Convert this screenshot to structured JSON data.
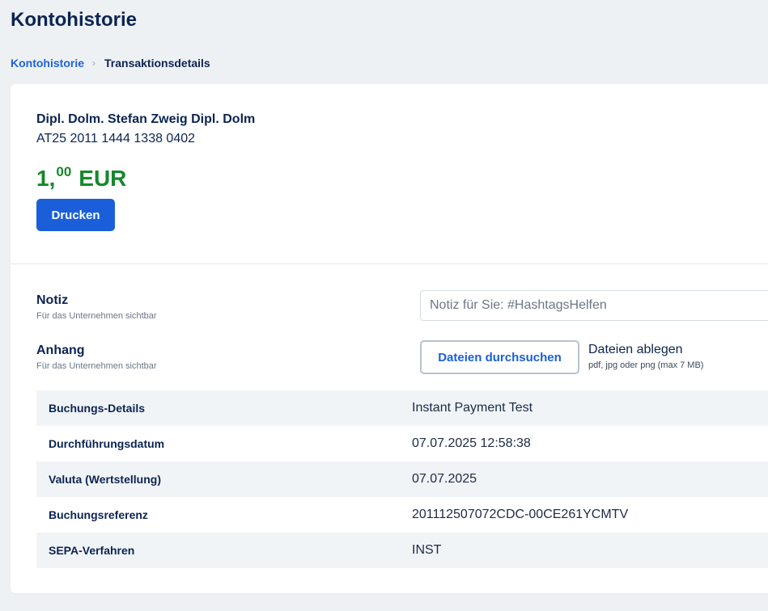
{
  "header": {
    "title": "Kontohistorie"
  },
  "breadcrumb": {
    "parent": "Kontohistorie",
    "separator": "›",
    "current": "Transaktionsdetails"
  },
  "transaction": {
    "name": "Dipl. Dolm. Stefan Zweig Dipl. Dolm",
    "iban": "AT25 2011 1444 1338 0402",
    "amount_major": "1,",
    "amount_minor": "00",
    "currency": "EUR",
    "amount_color": "#15892b"
  },
  "actions": {
    "print_label": "Drucken"
  },
  "note": {
    "label": "Notiz",
    "sublabel": "Für das Unternehmen sichtbar",
    "placeholder": "Notiz für Sie: #HashtagsHelfen"
  },
  "attachment": {
    "label": "Anhang",
    "sublabel": "Für das Unternehmen sichtbar",
    "browse_label": "Dateien durchsuchen",
    "drop_label": "Dateien ablegen",
    "hint": "pdf, jpg oder png (max 7 MB)"
  },
  "details": [
    {
      "key": "Buchungs-Details",
      "value": "Instant Payment Test"
    },
    {
      "key": "Durchführungsdatum",
      "value": "07.07.2025 12:58:38"
    },
    {
      "key": "Valuta (Wertstellung)",
      "value": "07.07.2025"
    },
    {
      "key": "Buchungsreferenz",
      "value": "201112507072CDC-00CE261YCMTV"
    },
    {
      "key": "SEPA-Verfahren",
      "value": "INST"
    }
  ],
  "colors": {
    "accent": "#1a5fd9",
    "title": "#0b2452",
    "background": "#eef1f4"
  }
}
